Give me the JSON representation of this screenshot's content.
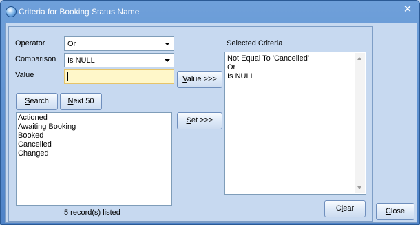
{
  "window": {
    "title": "Criteria for Booking Status Name"
  },
  "form": {
    "operator": {
      "label": "Operator",
      "value": "Or"
    },
    "comparison": {
      "label": "Comparison",
      "value": "Is NULL"
    },
    "value": {
      "label": "Value",
      "text": ""
    }
  },
  "buttons": {
    "value_underline": "V",
    "value_rest": "alue >>>",
    "search_underline": "S",
    "search_rest": "earch",
    "next_underline": "N",
    "next_rest": "ext 50",
    "set_underline": "S",
    "set_rest": "et >>>",
    "clear_pre": "C",
    "clear_underline": "l",
    "clear_rest": "ear",
    "close_pre": "",
    "close_underline": "C",
    "close_rest": "lose"
  },
  "results": {
    "items": [
      "Actioned",
      "Awaiting Booking",
      "Booked",
      "Cancelled",
      "Changed"
    ],
    "status": "5 record(s) listed"
  },
  "selected": {
    "label": "Selected Criteria",
    "lines": [
      "Not Equal To 'Cancelled'",
      "Or",
      "Is NULL"
    ]
  },
  "icons": {
    "title": "app-globe-icon",
    "close": "close-icon",
    "dropdown": "chevron-down-icon"
  }
}
